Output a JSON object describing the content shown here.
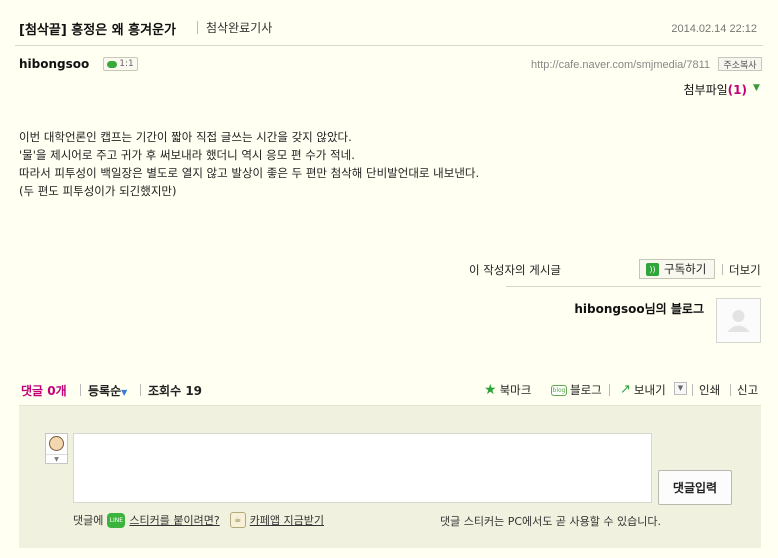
{
  "post": {
    "title": "[첨삭끝] 흥정은 왜 흥겨운가",
    "board": "첨삭완료기사",
    "date": "2014.02.14 22:12",
    "author": "hibongsoo",
    "chat_label": "1:1",
    "url": "http://cafe.naver.com/smjmedia/7811",
    "copy_label": "주소복사",
    "attach_label": "첨부파일",
    "attach_count": "1",
    "body": [
      "이번 대학언론인 캡프는 기간이 짧아 직접 글쓰는 시간을 갖지 않았다.",
      "'물'을 제시어로 주고 귀가 후 써보내라 했더니 역시 응모 편 수가 적네.",
      "따라서 피투성이 백일장은 별도로 열지 않고 발상이 좋은 두 편만 첨삭해 단비발언대로 내보낸다.",
      "(두 편도 피투성이가 되긴했지만)"
    ]
  },
  "author_tools": {
    "more_posts_label": "이 작성자의 게시글",
    "subscribe_label": "구독하기",
    "more_label": "더보기",
    "blog_label": "hibongsoo님의 블로그"
  },
  "comment_bar": {
    "comment_label": "댓글",
    "comment_count": "0개",
    "order_label": "등록순",
    "views_label": "조회수",
    "views_count": "19",
    "bookmark_label": "북마크",
    "blog_label": "블로그",
    "blog_icon_text": "blog",
    "send_label": "보내기",
    "print_label": "인쇄",
    "report_label": "신고"
  },
  "comment_form": {
    "submit_label": "댓글입력",
    "sticker_prefix": "댓글에",
    "line_icon_text": "LINE",
    "sticker_link": "스티커를 붙이려면?",
    "cafe_app_link": "카페앱 지금받기",
    "sticker_note": "댓글 스티커는 PC에서도 곧 사용할 수 있습니다."
  },
  "colors": {
    "background": "#fffff2",
    "accent_pink": "#c1007a",
    "accent_green": "#2ea33a",
    "panel": "#f1f1df"
  },
  "icons": [
    "chat-icon",
    "download-arrow-icon",
    "rss-icon",
    "star-icon",
    "blog-icon",
    "send-icon",
    "line-icon",
    "cafe-app-icon",
    "avatar-placeholder-icon"
  ]
}
